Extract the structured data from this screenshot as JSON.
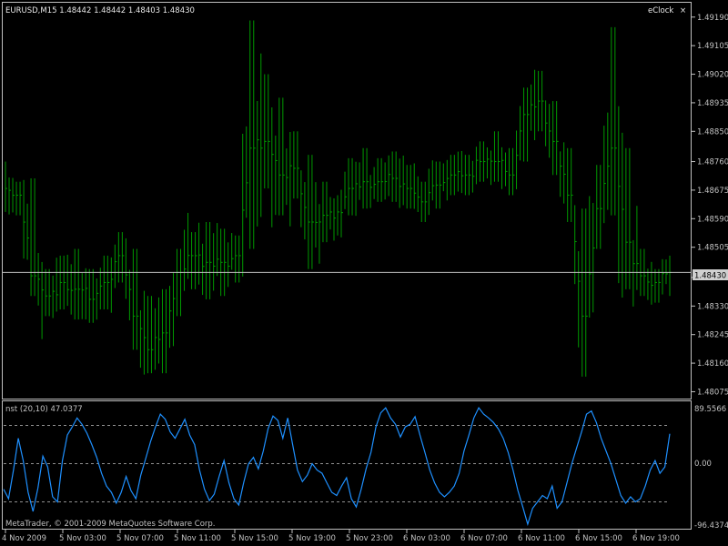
{
  "header": {
    "symbol_line": "EURUSD,M15  1.48442 1.48442 1.48403 1.48430",
    "ea_name": "eClock",
    "close_glyph": "×"
  },
  "indicator": {
    "label": "nst (20,10) 47.0377",
    "scale_labels": [
      "89.5566",
      "0.00",
      "-96.4374"
    ],
    "range": [
      -96.4374,
      89.5566
    ],
    "levels": [
      60,
      0,
      -60
    ]
  },
  "footer": {
    "copyright": "MetaTrader, © 2001-2009 MetaQuotes Software Corp."
  },
  "colors": {
    "background": "#000000",
    "bar": "#009a00",
    "indicator_line": "#1e90ff",
    "grid": "#c0c0c0",
    "current_price_line": "#c0c0c0",
    "price_label_bg": "#d0d0d0"
  },
  "chart_data": [
    {
      "type": "bar",
      "title": "EURUSD,M15",
      "price_scale": [
        "1.49190",
        "1.49105",
        "1.49020",
        "1.48935",
        "1.48850",
        "1.48760",
        "1.48675",
        "1.48590",
        "1.48505",
        "1.48415",
        "1.48330",
        "1.48245",
        "1.48160",
        "1.48075"
      ],
      "current_price": "1.48430",
      "ylim": [
        1.4806,
        1.4923
      ],
      "time_labels": [
        "4 Nov 2009",
        "5 Nov 03:00",
        "5 Nov 07:00",
        "5 Nov 11:00",
        "5 Nov 15:00",
        "5 Nov 19:00",
        "5 Nov 23:00",
        "6 Nov 03:00",
        "6 Nov 07:00",
        "6 Nov 11:00",
        "6 Nov 15:00",
        "6 Nov 19:00"
      ],
      "bar_count": 183,
      "ohlc_sampled": [
        {
          "high": 1.4876,
          "low": 1.4861,
          "close": 1.4868
        },
        {
          "high": 1.487,
          "low": 1.486,
          "close": 1.4866
        },
        {
          "high": 1.4871,
          "low": 1.4836,
          "close": 1.4842
        },
        {
          "high": 1.4844,
          "low": 1.483,
          "close": 1.4836
        },
        {
          "high": 1.4848,
          "low": 1.4832,
          "close": 1.484
        },
        {
          "high": 1.485,
          "low": 1.4829,
          "close": 1.4838
        },
        {
          "high": 1.4844,
          "low": 1.4828,
          "close": 1.4835
        },
        {
          "high": 1.4848,
          "low": 1.4832,
          "close": 1.484
        },
        {
          "high": 1.4855,
          "low": 1.484,
          "close": 1.4848
        },
        {
          "high": 1.485,
          "low": 1.482,
          "close": 1.483
        },
        {
          "high": 1.4836,
          "low": 1.4813,
          "close": 1.482
        },
        {
          "high": 1.4838,
          "low": 1.4813,
          "close": 1.4825
        },
        {
          "high": 1.485,
          "low": 1.483,
          "close": 1.4843
        },
        {
          "high": 1.4855,
          "low": 1.4838,
          "close": 1.4848
        },
        {
          "high": 1.4858,
          "low": 1.4835,
          "close": 1.4846
        },
        {
          "high": 1.4856,
          "low": 1.4836,
          "close": 1.4846
        },
        {
          "high": 1.4854,
          "low": 1.484,
          "close": 1.4848
        },
        {
          "high": 1.4918,
          "low": 1.485,
          "close": 1.488
        },
        {
          "high": 1.4902,
          "low": 1.4868,
          "close": 1.4882
        },
        {
          "high": 1.4895,
          "low": 1.486,
          "close": 1.4872
        },
        {
          "high": 1.4885,
          "low": 1.4865,
          "close": 1.4874
        },
        {
          "high": 1.4878,
          "low": 1.4844,
          "close": 1.4858
        },
        {
          "high": 1.487,
          "low": 1.4852,
          "close": 1.486
        },
        {
          "high": 1.4866,
          "low": 1.4854,
          "close": 1.4861
        },
        {
          "high": 1.4877,
          "low": 1.486,
          "close": 1.4868
        },
        {
          "high": 1.488,
          "low": 1.4862,
          "close": 1.487
        },
        {
          "high": 1.4877,
          "low": 1.4864,
          "close": 1.487
        },
        {
          "high": 1.4879,
          "low": 1.4864,
          "close": 1.4871
        },
        {
          "high": 1.4875,
          "low": 1.4862,
          "close": 1.4868
        },
        {
          "high": 1.487,
          "low": 1.4858,
          "close": 1.4864
        },
        {
          "high": 1.4876,
          "low": 1.4862,
          "close": 1.4869
        },
        {
          "high": 1.4878,
          "low": 1.4866,
          "close": 1.4872
        },
        {
          "high": 1.4878,
          "low": 1.4866,
          "close": 1.4872
        },
        {
          "high": 1.4882,
          "low": 1.487,
          "close": 1.4876
        },
        {
          "high": 1.4885,
          "low": 1.487,
          "close": 1.4876
        },
        {
          "high": 1.488,
          "low": 1.4866,
          "close": 1.4872
        },
        {
          "high": 1.4898,
          "low": 1.4876,
          "close": 1.489
        },
        {
          "high": 1.4903,
          "low": 1.4885,
          "close": 1.4894
        },
        {
          "high": 1.4894,
          "low": 1.4872,
          "close": 1.4882
        },
        {
          "high": 1.488,
          "low": 1.4858,
          "close": 1.4866
        },
        {
          "high": 1.4862,
          "low": 1.4812,
          "close": 1.483
        },
        {
          "high": 1.4875,
          "low": 1.485,
          "close": 1.4862
        },
        {
          "high": 1.4916,
          "low": 1.486,
          "close": 1.488
        },
        {
          "high": 1.488,
          "low": 1.4838,
          "close": 1.4852
        },
        {
          "high": 1.485,
          "low": 1.4836,
          "close": 1.4842
        },
        {
          "high": 1.4844,
          "low": 1.4834,
          "close": 1.484
        },
        {
          "high": 1.4848,
          "low": 1.4836,
          "close": 1.4843
        }
      ]
    },
    {
      "type": "line",
      "title": "nst (20,10) 47.0377",
      "ylim": [
        -96.4374,
        89.5566
      ],
      "levels": [
        60,
        0,
        -60
      ],
      "values": [
        -40,
        -55,
        -10,
        40,
        5,
        -45,
        -75,
        -38,
        12,
        -5,
        -52,
        -60,
        5,
        45,
        58,
        72,
        62,
        48,
        30,
        10,
        -15,
        -35,
        -45,
        -62,
        -45,
        -20,
        -42,
        -55,
        -18,
        8,
        35,
        58,
        78,
        70,
        50,
        40,
        55,
        70,
        45,
        30,
        -10,
        -40,
        -58,
        -48,
        -20,
        5,
        -30,
        -55,
        -65,
        -30,
        0,
        10,
        -8,
        20,
        55,
        75,
        68,
        40,
        72,
        30,
        -10,
        -28,
        -18,
        0,
        -10,
        -15,
        -30,
        -45,
        -50,
        -35,
        -22,
        -55,
        -68,
        -40,
        -8,
        18,
        58,
        80,
        88,
        72,
        62,
        42,
        58,
        62,
        74,
        45,
        18,
        -10,
        -30,
        -45,
        -52,
        -45,
        -35,
        -15,
        20,
        45,
        72,
        88,
        78,
        72,
        65,
        55,
        40,
        18,
        -10,
        -42,
        -68,
        -95,
        -70,
        -60,
        -50,
        -55,
        -35,
        -70,
        -60,
        -30,
        0,
        25,
        50,
        78,
        83,
        65,
        40,
        20,
        0,
        -25,
        -50,
        -62,
        -52,
        -60,
        -55,
        -35,
        -10,
        5,
        -15,
        -5,
        47
      ]
    }
  ]
}
